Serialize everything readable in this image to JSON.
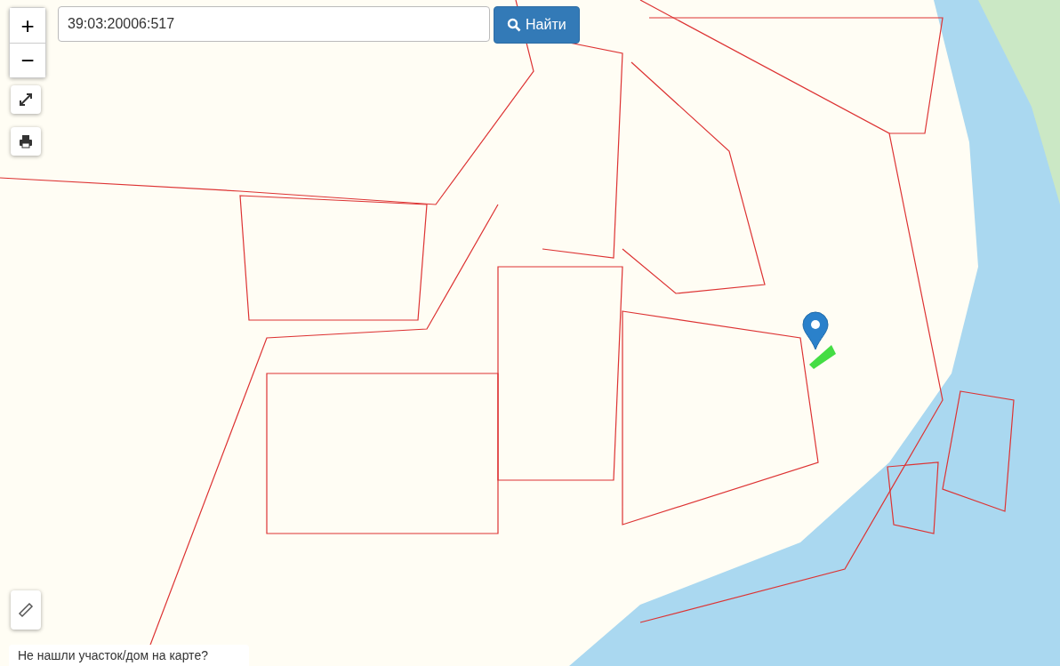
{
  "zoom_controls": [
    {
      "label": "+"
    },
    {
      "label": "−"
    }
  ],
  "search": {
    "value": "39:03:20006:517",
    "button": "Найти"
  },
  "footer": {
    "prompt": "Не нашли участок/дом на карте?"
  }
}
